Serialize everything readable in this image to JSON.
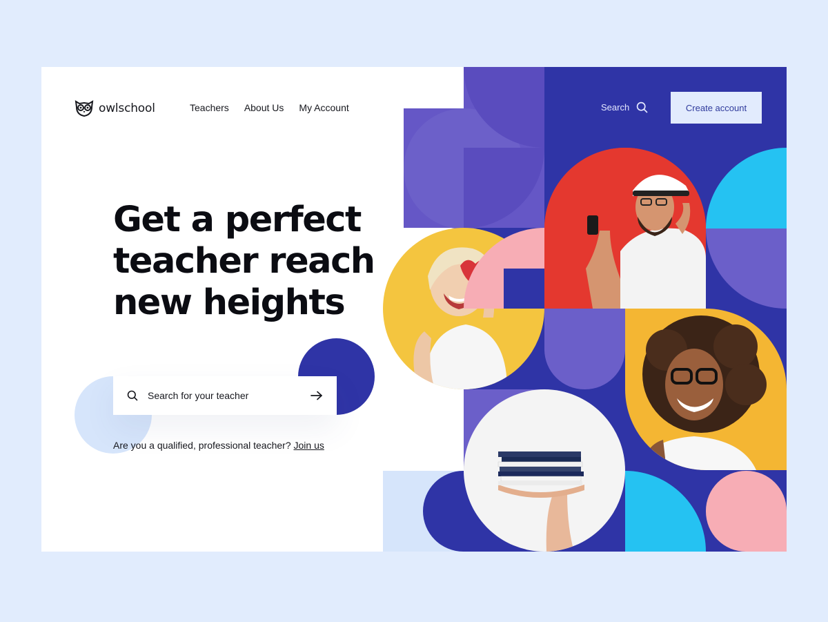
{
  "brand": {
    "name": "owlschool"
  },
  "nav": {
    "teachers": "Teachers",
    "about": "About Us",
    "account": "My Account"
  },
  "header": {
    "search_label": "Search",
    "create_account": "Create account"
  },
  "hero": {
    "title_line1": "Get a perfect",
    "title_line2": "teacher reach",
    "title_line3": "new heights"
  },
  "search": {
    "placeholder": "Search for your teacher"
  },
  "cta": {
    "question": "Are you a qualified, professional teacher?",
    "link": "Join us"
  },
  "colors": {
    "navy": "#2f34a6",
    "violet": "#6b5fc9",
    "pink": "#f7adb5",
    "cyan": "#25c2f2",
    "yellow": "#f4b633",
    "red": "#e43c33",
    "light_blue": "#d6e5fb"
  },
  "icons": [
    "owl-logo-icon",
    "search-icon",
    "arrow-right-icon"
  ],
  "photos": [
    "woman-with-heart-photo",
    "bearded-man-with-phone-photo",
    "curly-hair-woman-photo",
    "hand-holding-books-photo"
  ]
}
